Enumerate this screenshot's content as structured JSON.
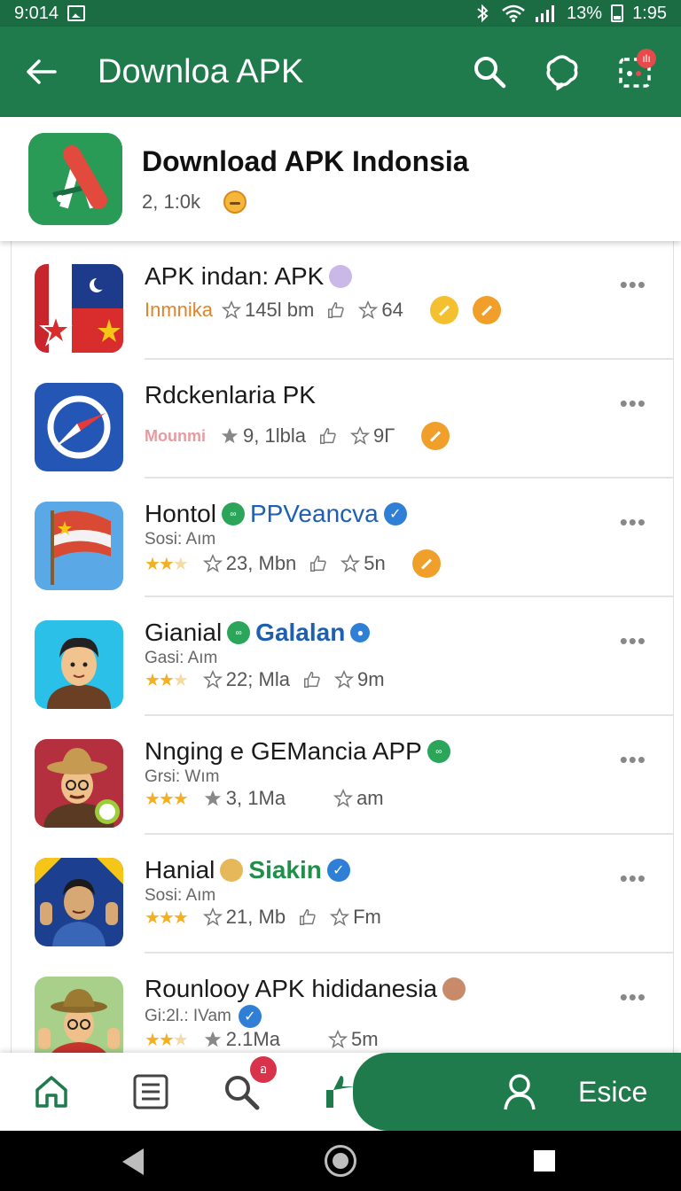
{
  "status_bar": {
    "time": "9:014",
    "battery": "13%",
    "clock": "1:95"
  },
  "app_bar": {
    "title": "Downloa APK",
    "notification_badge": "ılı"
  },
  "header": {
    "title": "Download APK Indonsia",
    "count": "2, 1:0k"
  },
  "items": [
    {
      "title": "APK indan: APK",
      "tag": "",
      "subtitle": "Inmnika",
      "size": "145l bm",
      "likes": "64"
    },
    {
      "title": "Rdckenlaria PK",
      "tag": "",
      "subtitle": "Mounmi",
      "size": "9, 1lbla",
      "likes": "9Г"
    },
    {
      "title": "Hontol",
      "tag": "PPVeancva",
      "subtitle": "Sosi: Aım",
      "size": "23, Mbn",
      "likes": "5n"
    },
    {
      "title": "Gianial",
      "tag": "Galalan",
      "subtitle": "Gasi: Aım",
      "size": "22; Mla",
      "likes": "9m"
    },
    {
      "title": "Nnging e GEMancia APP",
      "tag": "",
      "subtitle": "Grsi: Wım",
      "size": "3, 1Ma",
      "likes": "am"
    },
    {
      "title": "Hanial",
      "tag": "Siakin",
      "subtitle": "Sosi: Aım",
      "size": "21, Mb",
      "likes": "Fm"
    },
    {
      "title": "Rounlooy APK hididanesia",
      "tag": "",
      "subtitle": "Gi:2l.: IVam",
      "size": "2.1Ma",
      "likes": "5m"
    }
  ],
  "bottom_nav": {
    "search_badge": "อ",
    "profile_label": "Esice"
  },
  "colors": {
    "primary": "#1f7a4c",
    "accent_orange": "#f0a02a",
    "verified_blue": "#2f7fd6"
  }
}
